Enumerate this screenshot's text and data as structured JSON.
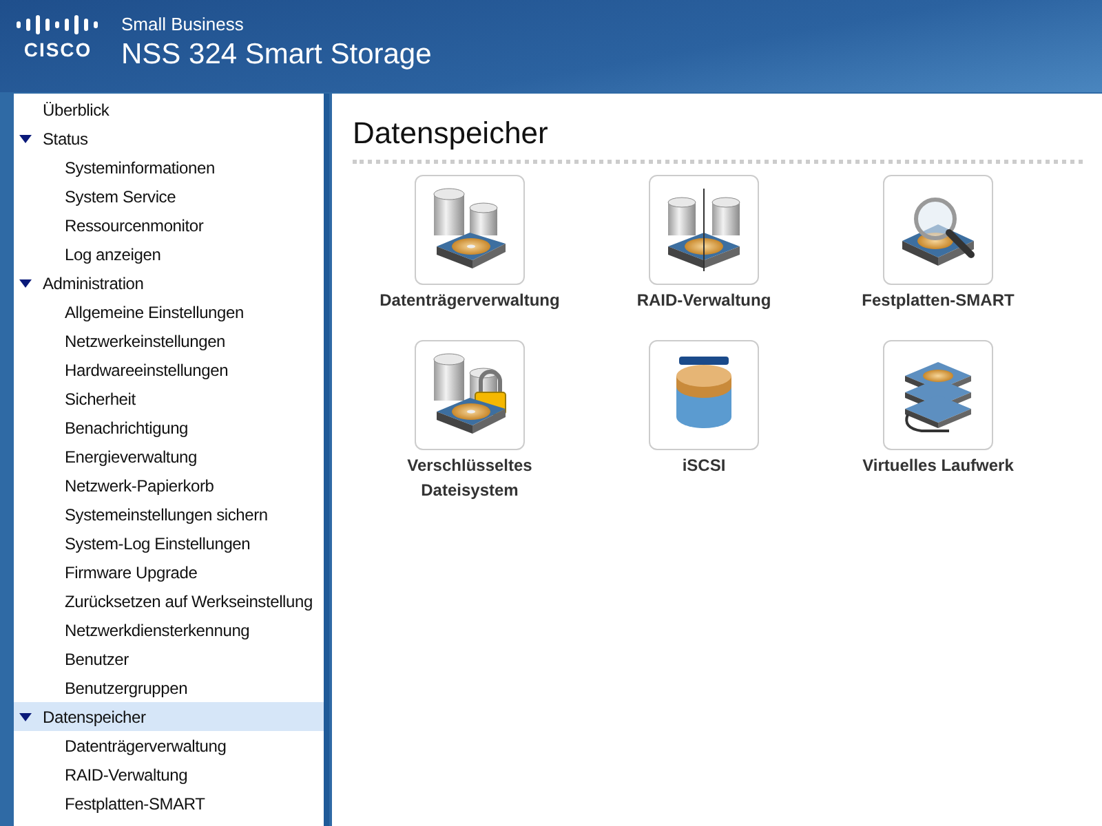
{
  "header": {
    "logo_text": "CISCO",
    "subtitle": "Small Business",
    "title": "NSS 324 Smart Storage"
  },
  "sidebar": {
    "items": [
      {
        "label": "Überblick",
        "selected": false
      },
      {
        "label": "Status",
        "selected": false,
        "expanded": true,
        "children": [
          {
            "label": "Systeminformationen",
            "selected": false
          },
          {
            "label": "System Service",
            "selected": false
          },
          {
            "label": "Ressourcenmonitor",
            "selected": false
          },
          {
            "label": "Log anzeigen",
            "selected": false
          }
        ]
      },
      {
        "label": "Administration",
        "selected": false,
        "expanded": true,
        "children": [
          {
            "label": "Allgemeine Einstellungen",
            "selected": false
          },
          {
            "label": "Netzwerkeinstellungen",
            "selected": false
          },
          {
            "label": "Hardwareeinstellungen",
            "selected": false
          },
          {
            "label": "Sicherheit",
            "selected": false
          },
          {
            "label": "Benachrichtigung",
            "selected": false
          },
          {
            "label": "Energieverwaltung",
            "selected": false
          },
          {
            "label": "Netzwerk-Papierkorb",
            "selected": false
          },
          {
            "label": "Systemeinstellungen sichern",
            "selected": false
          },
          {
            "label": "System-Log Einstellungen",
            "selected": false
          },
          {
            "label": "Firmware Upgrade",
            "selected": false
          },
          {
            "label": "Zurücksetzen auf Werkseinstellung",
            "selected": false
          },
          {
            "label": "Netzwerkdiensterkennung",
            "selected": false
          },
          {
            "label": "Benutzer",
            "selected": false
          },
          {
            "label": "Benutzergruppen",
            "selected": false
          }
        ]
      },
      {
        "label": "Datenspeicher",
        "selected": true,
        "expanded": true,
        "children": [
          {
            "label": "Datenträgerverwaltung",
            "selected": false
          },
          {
            "label": "RAID-Verwaltung",
            "selected": false
          },
          {
            "label": "Festplatten-SMART",
            "selected": false
          }
        ]
      }
    ]
  },
  "content": {
    "title": "Datenspeicher",
    "tiles": [
      {
        "kind": "volume",
        "label": "Datenträgerverwaltung"
      },
      {
        "kind": "raid",
        "label": "RAID-Verwaltung"
      },
      {
        "kind": "smart",
        "label": "Festplatten-SMART"
      },
      {
        "kind": "encrypted",
        "label": "Verschlüsseltes Dateisystem"
      },
      {
        "kind": "iscsi",
        "label": "iSCSI"
      },
      {
        "kind": "virtual",
        "label": "Virtuelles Laufwerk"
      }
    ]
  }
}
